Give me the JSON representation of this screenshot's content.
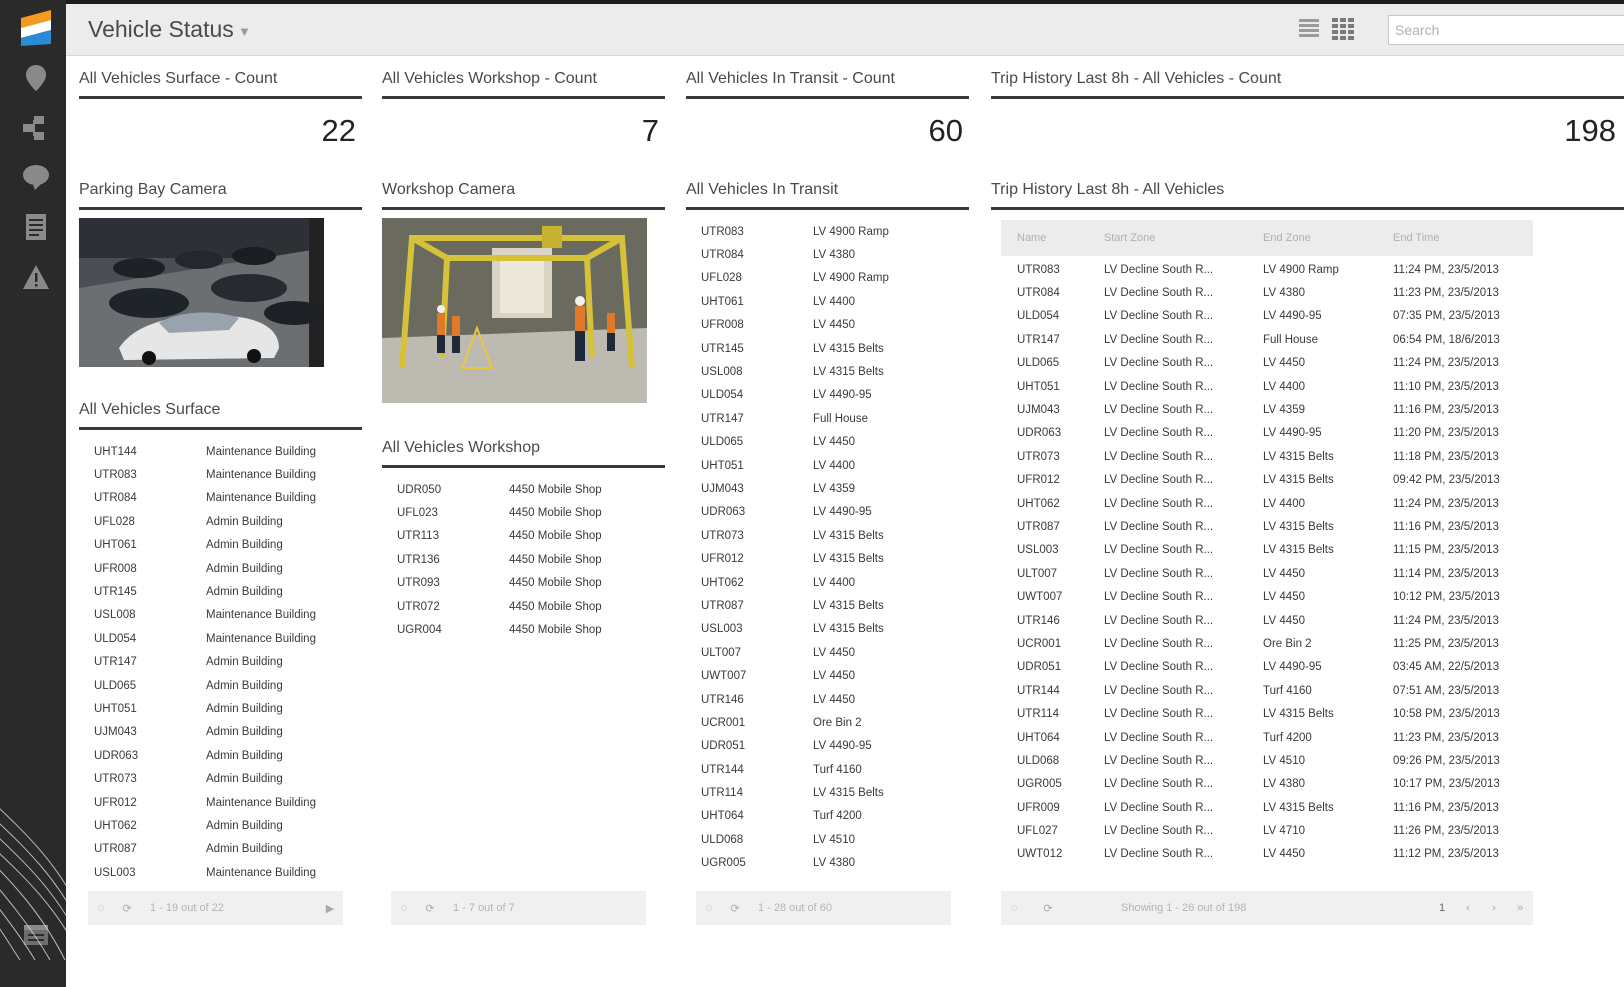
{
  "app": {
    "title": "Vehicle Status",
    "search_placeholder": "Search"
  },
  "sidebar": {
    "items": [
      {
        "icon": "map-pin-icon"
      },
      {
        "icon": "hierarchy-icon"
      },
      {
        "icon": "chat-bubble-icon"
      },
      {
        "icon": "document-icon"
      },
      {
        "icon": "warning-icon"
      },
      {
        "icon": "calendar-icon"
      }
    ]
  },
  "counts": [
    {
      "title": "All Vehicles Surface - Count",
      "value": "22"
    },
    {
      "title": "All Vehicles Workshop - Count",
      "value": "7"
    },
    {
      "title": "All Vehicles In Transit - Count",
      "value": "60"
    },
    {
      "title": "Trip History Last 8h - All Vehicles - Count",
      "value": "198"
    }
  ],
  "cameras": {
    "parking_title": "Parking Bay Camera",
    "workshop_title": "Workshop Camera"
  },
  "surface": {
    "title": "All Vehicles Surface",
    "rows": [
      [
        "UHT144",
        "Maintenance Building"
      ],
      [
        "UTR083",
        "Maintenance Building"
      ],
      [
        "UTR084",
        "Maintenance Building"
      ],
      [
        "UFL028",
        "Admin Building"
      ],
      [
        "UHT061",
        "Admin Building"
      ],
      [
        "UFR008",
        "Admin Building"
      ],
      [
        "UTR145",
        "Admin Building"
      ],
      [
        "USL008",
        "Maintenance Building"
      ],
      [
        "ULD054",
        "Maintenance Building"
      ],
      [
        "UTR147",
        "Admin Building"
      ],
      [
        "ULD065",
        "Admin Building"
      ],
      [
        "UHT051",
        "Admin Building"
      ],
      [
        "UJM043",
        "Admin Building"
      ],
      [
        "UDR063",
        "Admin Building"
      ],
      [
        "UTR073",
        "Admin Building"
      ],
      [
        "UFR012",
        "Maintenance Building"
      ],
      [
        "UHT062",
        "Admin Building"
      ],
      [
        "UTR087",
        "Admin Building"
      ],
      [
        "USL003",
        "Maintenance Building"
      ]
    ],
    "pager": "1 - 19 out of 22"
  },
  "workshop": {
    "title": "All Vehicles Workshop",
    "rows": [
      [
        "UDR050",
        "4450 Mobile Shop"
      ],
      [
        "UFL023",
        "4450 Mobile Shop"
      ],
      [
        "UTR113",
        "4450 Mobile Shop"
      ],
      [
        "UTR136",
        "4450 Mobile Shop"
      ],
      [
        "UTR093",
        "4450 Mobile Shop"
      ],
      [
        "UTR072",
        "4450 Mobile Shop"
      ],
      [
        "UGR004",
        "4450 Mobile Shop"
      ]
    ],
    "pager": "1 - 7 out of 7"
  },
  "transit": {
    "title": "All Vehicles In Transit",
    "rows": [
      [
        "UTR083",
        "LV 4900 Ramp"
      ],
      [
        "UTR084",
        "LV 4380"
      ],
      [
        "UFL028",
        "LV 4900 Ramp"
      ],
      [
        "UHT061",
        "LV 4400"
      ],
      [
        "UFR008",
        "LV 4450"
      ],
      [
        "UTR145",
        "LV 4315 Belts"
      ],
      [
        "USL008",
        "LV 4315 Belts"
      ],
      [
        "ULD054",
        "LV 4490-95"
      ],
      [
        "UTR147",
        "Full House"
      ],
      [
        "ULD065",
        "LV 4450"
      ],
      [
        "UHT051",
        "LV 4400"
      ],
      [
        "UJM043",
        "LV 4359"
      ],
      [
        "UDR063",
        "LV 4490-95"
      ],
      [
        "UTR073",
        "LV 4315 Belts"
      ],
      [
        "UFR012",
        "LV 4315 Belts"
      ],
      [
        "UHT062",
        "LV 4400"
      ],
      [
        "UTR087",
        "LV 4315 Belts"
      ],
      [
        "USL003",
        "LV 4315 Belts"
      ],
      [
        "ULT007",
        "LV 4450"
      ],
      [
        "UWT007",
        "LV 4450"
      ],
      [
        "UTR146",
        "LV 4450"
      ],
      [
        "UCR001",
        "Ore Bin 2"
      ],
      [
        "UDR051",
        "LV 4490-95"
      ],
      [
        "UTR144",
        "Turf 4160"
      ],
      [
        "UTR114",
        "LV 4315 Belts"
      ],
      [
        "UHT064",
        "Turf 4200"
      ],
      [
        "ULD068",
        "LV 4510"
      ],
      [
        "UGR005",
        "LV 4380"
      ]
    ],
    "pager": "1 - 28 out of 60"
  },
  "trips": {
    "title": "Trip History Last 8h - All Vehicles",
    "headers": [
      "Name",
      "Start Zone",
      "End Zone",
      "End Time"
    ],
    "rows": [
      [
        "UTR083",
        "LV Decline South R...",
        "LV 4900 Ramp",
        "11:24 PM, 23/5/2013"
      ],
      [
        "UTR084",
        "LV Decline South R...",
        "LV 4380",
        "11:23 PM, 23/5/2013"
      ],
      [
        "ULD054",
        "LV Decline South R...",
        "LV 4490-95",
        "07:35 PM, 23/5/2013"
      ],
      [
        "UTR147",
        "LV Decline South R...",
        "Full House",
        "06:54 PM, 18/6/2013"
      ],
      [
        "ULD065",
        "LV Decline South R...",
        "LV 4450",
        "11:24 PM, 23/5/2013"
      ],
      [
        "UHT051",
        "LV Decline South R...",
        "LV 4400",
        "11:10 PM, 23/5/2013"
      ],
      [
        "UJM043",
        "LV Decline South R...",
        "LV 4359",
        "11:16 PM, 23/5/2013"
      ],
      [
        "UDR063",
        "LV Decline South R...",
        "LV 4490-95",
        "11:20 PM, 23/5/2013"
      ],
      [
        "UTR073",
        "LV Decline South R...",
        "LV 4315 Belts",
        "11:18 PM, 23/5/2013"
      ],
      [
        "UFR012",
        "LV Decline South R...",
        "LV 4315 Belts",
        "09:42 PM, 23/5/2013"
      ],
      [
        "UHT062",
        "LV Decline South R...",
        "LV 4400",
        "11:24 PM, 23/5/2013"
      ],
      [
        "UTR087",
        "LV Decline South R...",
        "LV 4315 Belts",
        "11:16 PM, 23/5/2013"
      ],
      [
        "USL003",
        "LV Decline South R...",
        "LV 4315 Belts",
        "11:15 PM, 23/5/2013"
      ],
      [
        "ULT007",
        "LV Decline South R...",
        "LV 4450",
        "11:14 PM, 23/5/2013"
      ],
      [
        "UWT007",
        "LV Decline South R...",
        "LV 4450",
        "10:12 PM, 23/5/2013"
      ],
      [
        "UTR146",
        "LV Decline South R...",
        "LV 4450",
        "11:24 PM, 23/5/2013"
      ],
      [
        "UCR001",
        "LV Decline South R...",
        "Ore Bin 2",
        "11:25 PM, 23/5/2013"
      ],
      [
        "UDR051",
        "LV Decline South R...",
        "LV 4490-95",
        "03:45 AM, 22/5/2013"
      ],
      [
        "UTR144",
        "LV Decline South R...",
        "Turf 4160",
        "07:51 AM, 23/5/2013"
      ],
      [
        "UTR114",
        "LV Decline South R...",
        "LV 4315 Belts",
        "10:58 PM, 23/5/2013"
      ],
      [
        "UHT064",
        "LV Decline South R...",
        "Turf 4200",
        "11:23 PM, 23/5/2013"
      ],
      [
        "ULD068",
        "LV Decline South R...",
        "LV 4510",
        "09:26 PM, 23/5/2013"
      ],
      [
        "UGR005",
        "LV Decline South R...",
        "LV 4380",
        "10:17 PM, 23/5/2013"
      ],
      [
        "UFR009",
        "LV Decline South R...",
        "LV 4315 Belts",
        "11:16 PM, 23/5/2013"
      ],
      [
        "UFL027",
        "LV Decline South R...",
        "LV 4710",
        "11:26 PM, 23/5/2013"
      ],
      [
        "UWT012",
        "LV Decline South R...",
        "LV 4450",
        "11:12 PM, 23/5/2013"
      ]
    ],
    "pager": "Showing 1 - 26 out of 198",
    "page_number": "1"
  }
}
